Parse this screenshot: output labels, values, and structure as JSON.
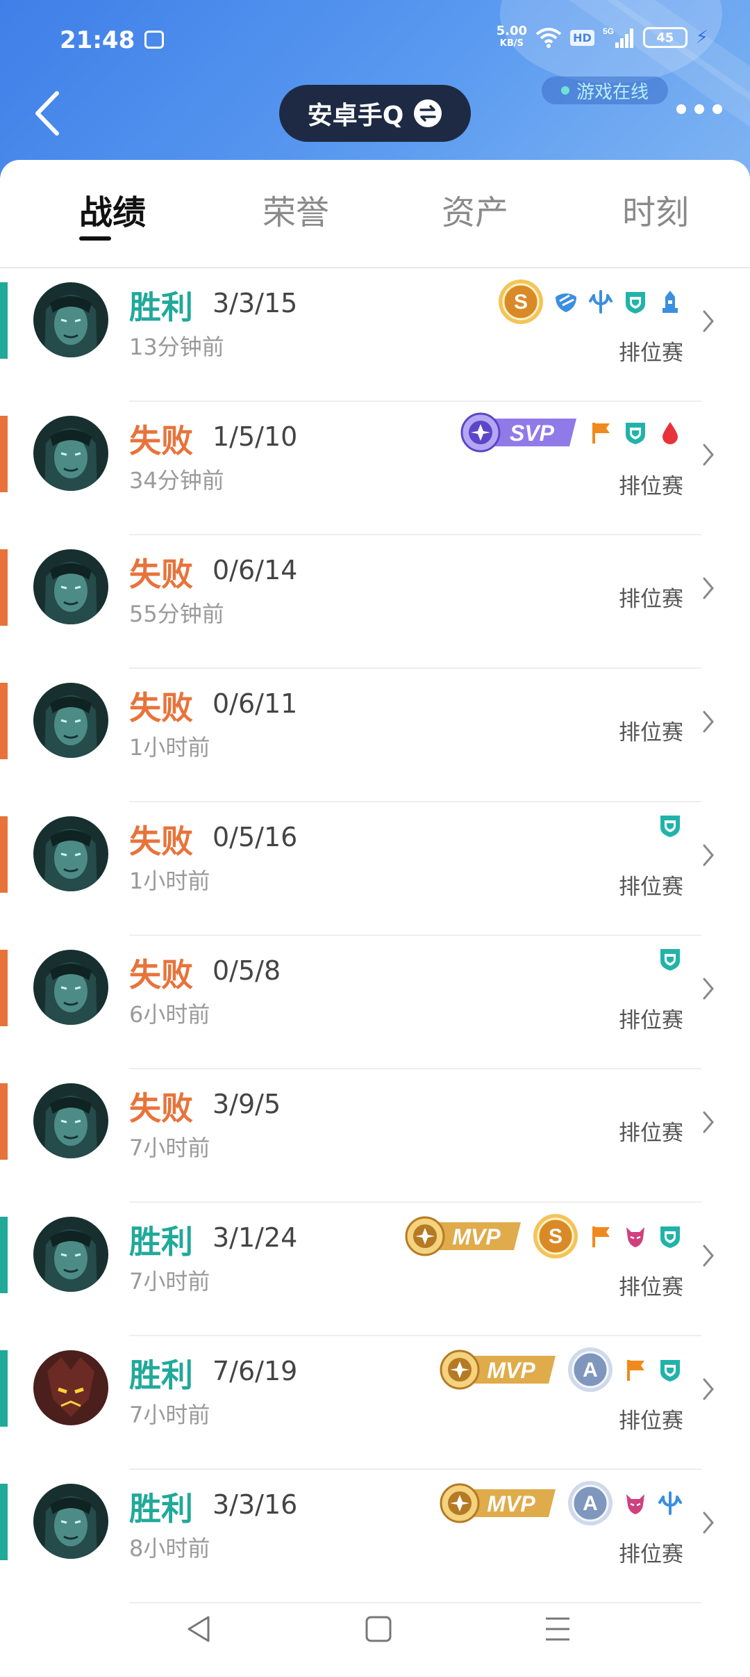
{
  "status_bar": {
    "time": "21:48",
    "net_speed": "5.00",
    "net_unit": "KB/S",
    "hd": "HD",
    "network": "5G",
    "battery": "45"
  },
  "header": {
    "account_name": "安卓手Q",
    "online_status": "游戏在线"
  },
  "tabs": [
    {
      "label": "战绩",
      "active": true
    },
    {
      "label": "荣誉",
      "active": false
    },
    {
      "label": "资产",
      "active": false
    },
    {
      "label": "时刻",
      "active": false
    }
  ],
  "colors": {
    "win": "#21a99a",
    "loss": "#e8733a",
    "header_start": "#3f7fe8",
    "account_pill": "#1e2a44"
  },
  "matches": [
    {
      "result": "胜利",
      "outcome": "win",
      "kda": "3/3/15",
      "time_ago": "13分钟前",
      "mode": "排位赛",
      "badges": [
        "s-coin",
        "mask-icon",
        "trident-icon",
        "shield-icon",
        "tower-icon"
      ]
    },
    {
      "result": "失败",
      "outcome": "loss",
      "kda": "1/5/10",
      "time_ago": "34分钟前",
      "mode": "排位赛",
      "badges": [
        "svp-badge",
        "flag-icon",
        "shield-icon",
        "blood-icon"
      ]
    },
    {
      "result": "失败",
      "outcome": "loss",
      "kda": "0/6/14",
      "time_ago": "55分钟前",
      "mode": "排位赛",
      "badges": []
    },
    {
      "result": "失败",
      "outcome": "loss",
      "kda": "0/6/11",
      "time_ago": "1小时前",
      "mode": "排位赛",
      "badges": []
    },
    {
      "result": "失败",
      "outcome": "loss",
      "kda": "0/5/16",
      "time_ago": "1小时前",
      "mode": "排位赛",
      "badges": [
        "shield-icon"
      ]
    },
    {
      "result": "失败",
      "outcome": "loss",
      "kda": "0/5/8",
      "time_ago": "6小时前",
      "mode": "排位赛",
      "badges": [
        "shield-icon"
      ]
    },
    {
      "result": "失败",
      "outcome": "loss",
      "kda": "3/9/5",
      "time_ago": "7小时前",
      "mode": "排位赛",
      "badges": []
    },
    {
      "result": "胜利",
      "outcome": "win",
      "kda": "3/1/24",
      "time_ago": "7小时前",
      "mode": "排位赛",
      "badges": [
        "mvp-badge",
        "s-coin",
        "flag-icon",
        "demon-icon",
        "shield-icon"
      ]
    },
    {
      "result": "胜利",
      "outcome": "win",
      "kda": "7/6/19",
      "time_ago": "7小时前",
      "mode": "排位赛",
      "badges": [
        "mvp-badge",
        "a-coin",
        "flag-icon",
        "shield-icon"
      ]
    },
    {
      "result": "胜利",
      "outcome": "win",
      "kda": "3/3/16",
      "time_ago": "8小时前",
      "mode": "排位赛",
      "badges": [
        "mvp-badge",
        "a-coin",
        "demon-icon",
        "trident-icon"
      ]
    }
  ],
  "badge_text": {
    "svp": "SVP",
    "mvp": "MVP",
    "s": "S",
    "a": "A"
  },
  "avatars": [
    "hero-a",
    "hero-a",
    "hero-a",
    "hero-a",
    "hero-a",
    "hero-a",
    "hero-a",
    "hero-a",
    "hero-b",
    "hero-a"
  ]
}
